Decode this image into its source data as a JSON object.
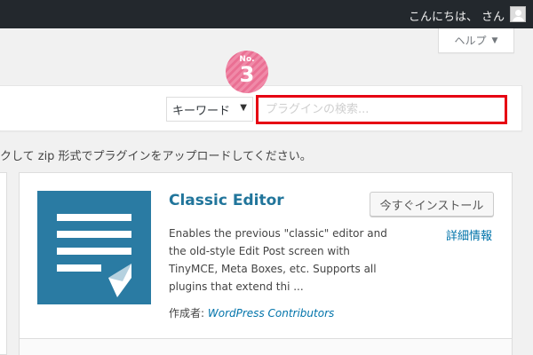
{
  "adminbar": {
    "greeting": "こんにちは、",
    "username": "さん"
  },
  "help": {
    "label": "ヘルプ"
  },
  "step_badge": {
    "prefix": "No.",
    "number": "3"
  },
  "search": {
    "filter_selected": "キーワード",
    "placeholder": "プラグインの検索..."
  },
  "upload_notice": "クして zip 形式でプラグインをアップロードしてください。",
  "plugin": {
    "title": "Classic Editor",
    "install_label": "今すぐインストール",
    "details_label": "詳細情報",
    "description": "Enables the previous \"classic\" editor and the old-style Edit Post screen with TinyMCE, Meta Boxes, etc. Supports all plugins that extend thi ...",
    "author_label": "作成者:",
    "author_name": "WordPress Contributors",
    "icon_color": "#2a7ba3"
  },
  "colors": {
    "adminbar_bg": "#23282d",
    "highlight_border": "#e60012",
    "link": "#0073aa",
    "badge_pink": "#ea6f93"
  }
}
